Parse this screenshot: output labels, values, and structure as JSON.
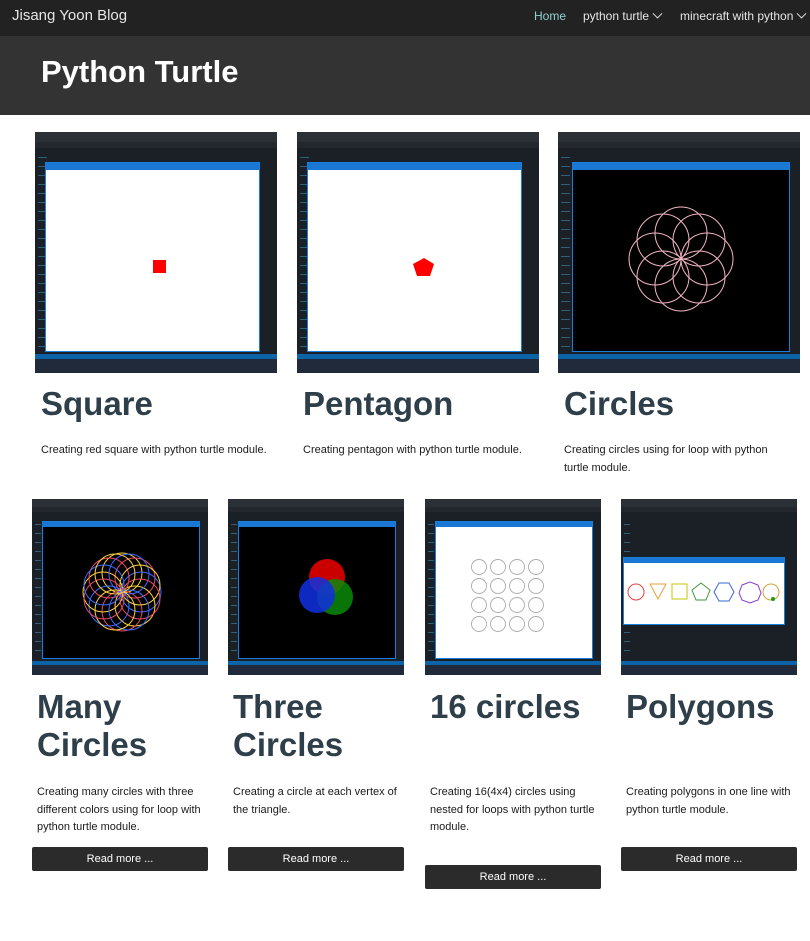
{
  "nav": {
    "brand": "Jisang Yoon Blog",
    "items": [
      {
        "label": "Home",
        "active": true
      },
      {
        "label": "python turtle",
        "dropdown": true
      },
      {
        "label": "minecraft with python",
        "dropdown": true
      }
    ]
  },
  "header": {
    "title": "Python Turtle"
  },
  "cards": [
    {
      "title": "Square",
      "description": "Creating red square with python turtle module.",
      "thumbnail_icon": "red-square-screenshot"
    },
    {
      "title": "Pentagon",
      "description": "Creating pentagon with python turtle module.",
      "thumbnail_icon": "red-pentagon-screenshot"
    },
    {
      "title": "Circles",
      "description": "Creating circles using for loop with python turtle module.",
      "thumbnail_icon": "pink-circles-screenshot"
    },
    {
      "title": "Many Circles",
      "description": "Creating many circles with three different colors using for loop with python turtle module.",
      "thumbnail_icon": "colored-circles-screenshot",
      "button": "Read more ..."
    },
    {
      "title": "Three Circles",
      "description": "Creating a circle at each vertex of the triangle.",
      "thumbnail_icon": "rgb-circles-screenshot",
      "button": "Read more ..."
    },
    {
      "title": "16 circles",
      "description": "Creating 16(4x4) circles using nested for loops with python turtle module.",
      "thumbnail_icon": "grid-circles-screenshot",
      "button": "Read more ..."
    },
    {
      "title": "Polygons",
      "description": "Creating polygons in one line with python turtle module.",
      "thumbnail_icon": "polygons-screenshot",
      "button": "Read more ..."
    }
  ],
  "colors": {
    "nav_bg": "#222222",
    "header_bg": "#333333",
    "active": "#8fd3d0",
    "title": "#2e3f4a",
    "button_bg": "#2b2b2b"
  }
}
